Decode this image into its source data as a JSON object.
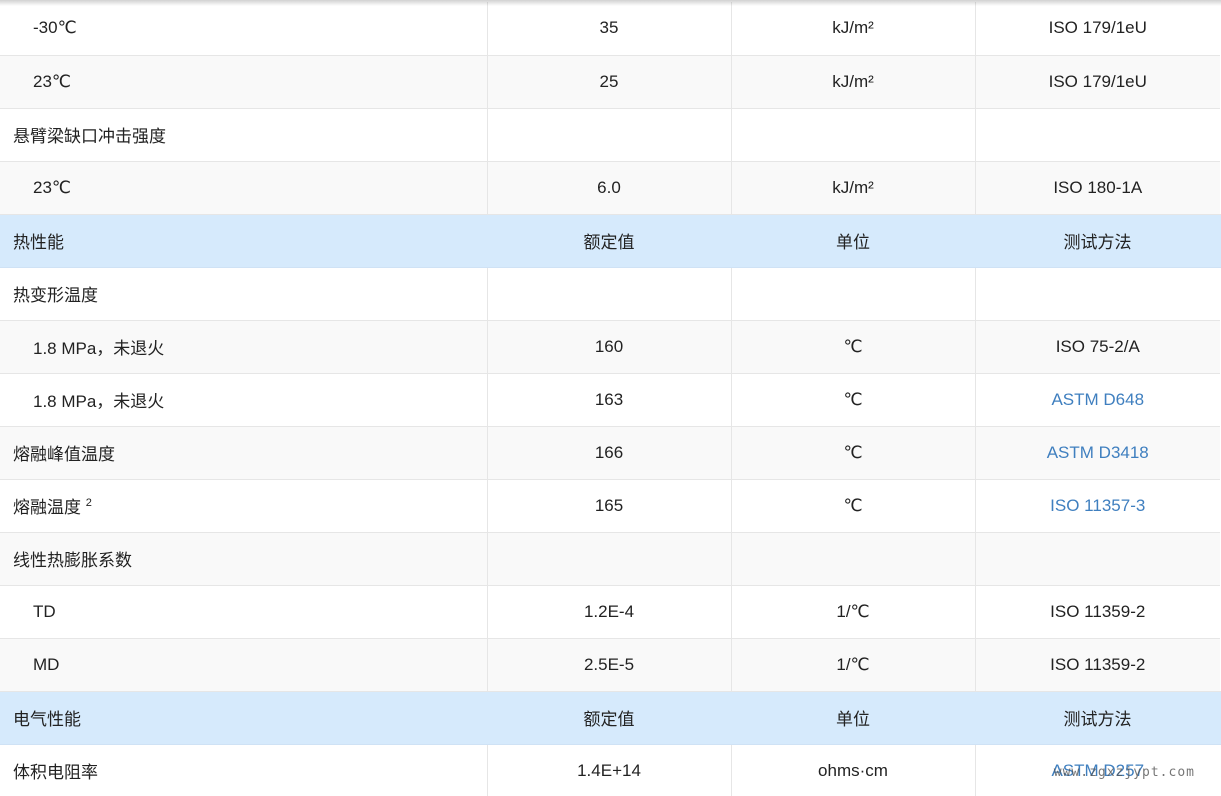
{
  "rows": [
    {
      "type": "data",
      "indent": true,
      "name": "-30℃",
      "value": "35",
      "unit": "kJ/m²",
      "method": "ISO 179/1eU",
      "link": false
    },
    {
      "type": "data",
      "indent": true,
      "name": "23℃",
      "value": "25",
      "unit": "kJ/m²",
      "method": "ISO 179/1eU",
      "link": false
    },
    {
      "type": "data",
      "indent": false,
      "name": "悬臂梁缺口冲击强度",
      "value": "",
      "unit": "",
      "method": "",
      "link": false
    },
    {
      "type": "data",
      "indent": true,
      "name": "23℃",
      "value": "6.0",
      "unit": "kJ/m²",
      "method": "ISO 180-1A",
      "link": false
    },
    {
      "type": "section",
      "name": "热性能",
      "value": "额定值",
      "unit": "单位",
      "method": "测试方法"
    },
    {
      "type": "data",
      "indent": false,
      "name": "热变形温度",
      "value": "",
      "unit": "",
      "method": "",
      "link": false
    },
    {
      "type": "data",
      "indent": true,
      "name": "1.8 MPa，未退火",
      "value": "160",
      "unit": "℃",
      "method": "ISO 75-2/A",
      "link": false
    },
    {
      "type": "data",
      "indent": true,
      "name": "1.8 MPa，未退火",
      "value": "163",
      "unit": "℃",
      "method": "ASTM D648",
      "link": true
    },
    {
      "type": "data",
      "indent": false,
      "name": "熔融峰值温度",
      "value": "166",
      "unit": "℃",
      "method": "ASTM D3418",
      "link": true
    },
    {
      "type": "data",
      "indent": false,
      "name": "熔融温度",
      "sup": "2",
      "value": "165",
      "unit": "℃",
      "method": "ISO 11357-3",
      "link": true
    },
    {
      "type": "data",
      "indent": false,
      "name": "线性热膨胀系数",
      "value": "",
      "unit": "",
      "method": "",
      "link": false
    },
    {
      "type": "data",
      "indent": true,
      "name": "TD",
      "value": "1.2E-4",
      "unit": "1/℃",
      "method": "ISO 11359-2",
      "link": false
    },
    {
      "type": "data",
      "indent": true,
      "name": "MD",
      "value": "2.5E-5",
      "unit": "1/℃",
      "method": "ISO 11359-2",
      "link": false
    },
    {
      "type": "section",
      "name": "电气性能",
      "value": "额定值",
      "unit": "单位",
      "method": "测试方法"
    },
    {
      "type": "data",
      "indent": false,
      "name": "体积电阻率",
      "value": "1.4E+14",
      "unit": "ohms·cm",
      "method": "ASTM D257",
      "link": true
    }
  ],
  "watermark": "www.zgxzjypt.com",
  "colors": {
    "section_bg": "#d6eafc",
    "link": "#3f7fbf",
    "row_alt": "#f9f9f9",
    "border": "#e6e6e6"
  }
}
